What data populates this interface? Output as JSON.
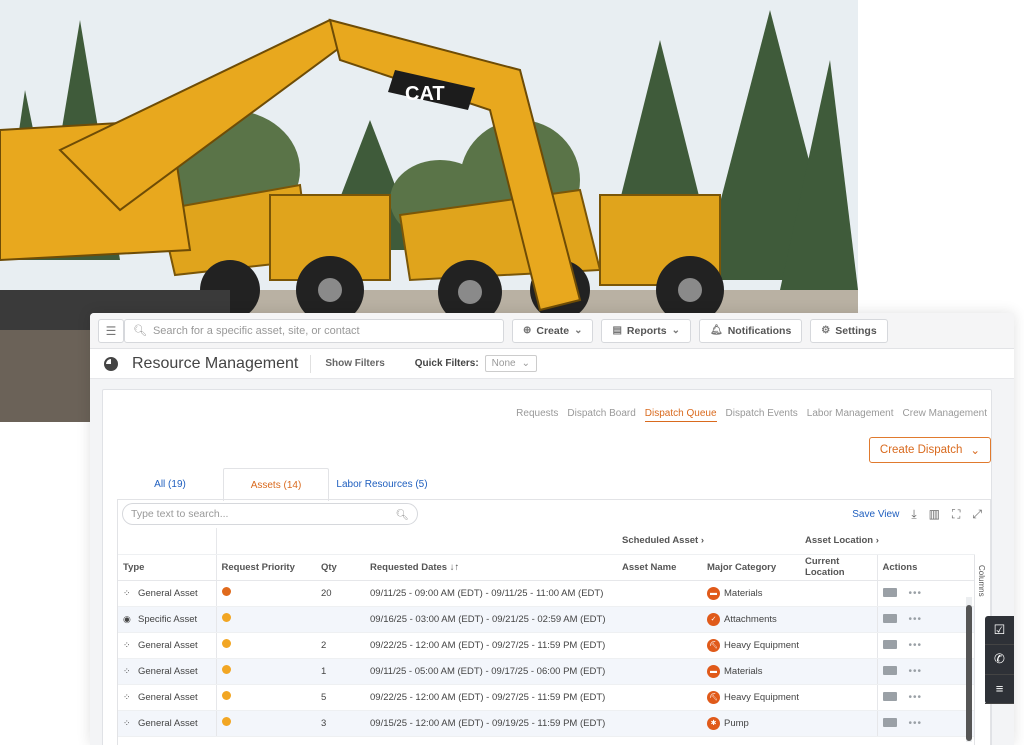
{
  "toolbar": {
    "search_placeholder": "Search for a specific asset, site, or contact",
    "create": "Create",
    "reports": "Reports",
    "notifications": "Notifications",
    "settings": "Settings"
  },
  "header": {
    "title": "Resource Management",
    "show_filters": "Show Filters",
    "quick_filters_label": "Quick Filters:",
    "quick_filters_value": "None"
  },
  "subnav": [
    "Requests",
    "Dispatch Board",
    "Dispatch Queue",
    "Dispatch Events",
    "Labor Management",
    "Crew Management"
  ],
  "subnav_active": "Dispatch Queue",
  "create_dispatch": "Create Dispatch",
  "tabs": [
    {
      "label": "All (19)",
      "active": false
    },
    {
      "label": "Assets (14)",
      "active": true
    },
    {
      "label": "Labor Resources (5)",
      "active": false
    }
  ],
  "grid": {
    "search_placeholder": "Type text to search...",
    "save_view": "Save View",
    "group_headers": {
      "scheduled_asset": "Scheduled Asset",
      "asset_location": "Asset Location"
    },
    "columns": [
      "Type",
      "Request Priority",
      "Qty",
      "Requested Dates",
      "Asset Name",
      "Major Category",
      "Current Location",
      "Actions"
    ],
    "columns_sidebar": "Columns",
    "rows": [
      {
        "type": "General Asset",
        "priority": "#e06a1c",
        "qty": "20",
        "dates": "09/11/25 - 09:00 AM (EDT) - 09/11/25 - 11:00 AM (EDT)",
        "asset": "",
        "category": "Materials",
        "location": ""
      },
      {
        "type": "Specific Asset",
        "priority": "#f2a623",
        "qty": "",
        "dates": "09/16/25 - 03:00 AM (EDT) - 09/21/25 - 02:59 AM (EDT)",
        "asset": "",
        "category": "Attachments",
        "location": ""
      },
      {
        "type": "General Asset",
        "priority": "#f2a623",
        "qty": "2",
        "dates": "09/22/25 - 12:00 AM (EDT) - 09/27/25 - 11:59 PM (EDT)",
        "asset": "",
        "category": "Heavy Equipment",
        "location": ""
      },
      {
        "type": "General Asset",
        "priority": "#f2a623",
        "qty": "1",
        "dates": "09/11/25 - 05:00 AM (EDT) - 09/17/25 - 06:00 PM (EDT)",
        "asset": "",
        "category": "Materials",
        "location": ""
      },
      {
        "type": "General Asset",
        "priority": "#f2a623",
        "qty": "5",
        "dates": "09/22/25 - 12:00 AM (EDT) - 09/27/25 - 11:59 PM (EDT)",
        "asset": "",
        "category": "Heavy Equipment",
        "location": ""
      },
      {
        "type": "General Asset",
        "priority": "#f2a623",
        "qty": "3",
        "dates": "09/15/25 - 12:00 AM (EDT) - 09/19/25 - 11:59 PM (EDT)",
        "asset": "",
        "category": "Pump",
        "location": ""
      }
    ]
  },
  "photo_logo": "CAT"
}
